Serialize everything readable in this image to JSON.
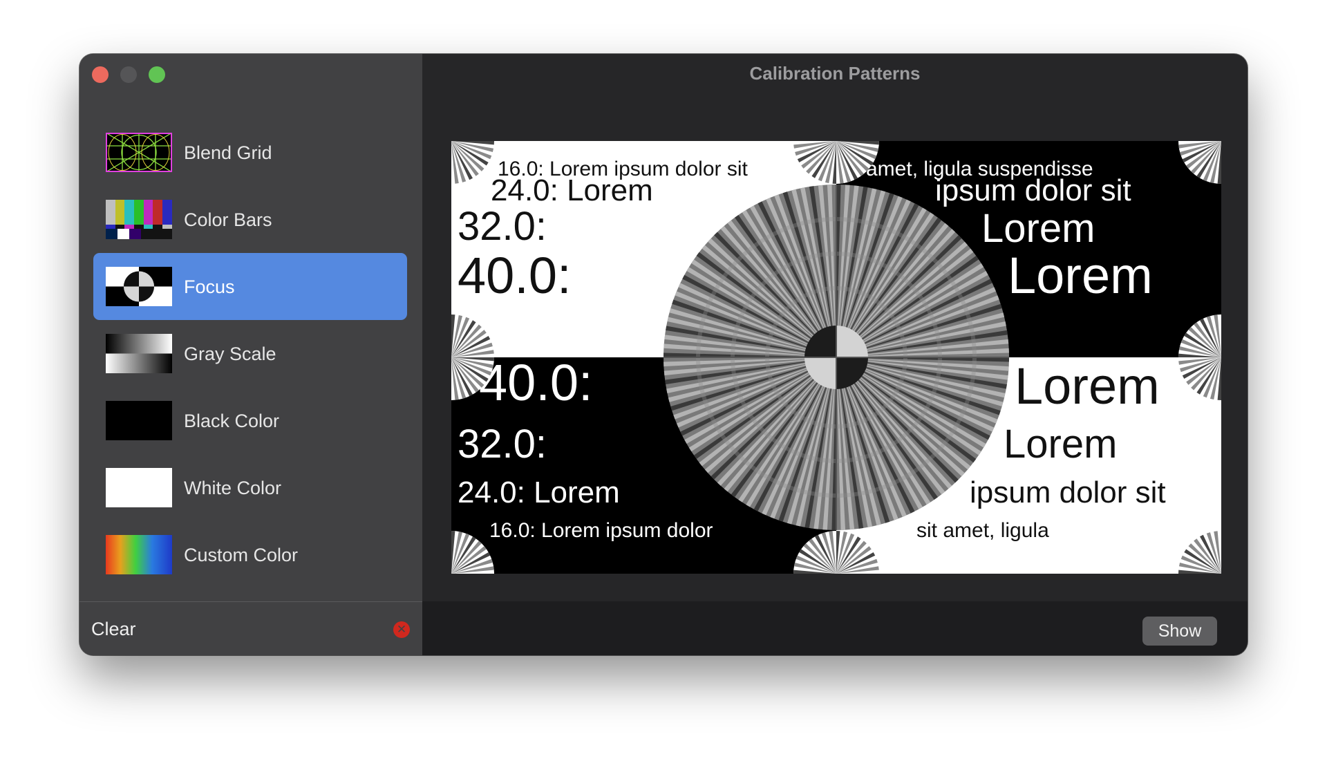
{
  "window": {
    "title": "Calibration Patterns"
  },
  "sidebar": {
    "items": [
      {
        "label": "Blend Grid",
        "icon": "blend-grid-icon",
        "selected": false
      },
      {
        "label": "Color Bars",
        "icon": "color-bars-icon",
        "selected": false
      },
      {
        "label": "Focus",
        "icon": "focus-icon",
        "selected": true
      },
      {
        "label": "Gray Scale",
        "icon": "gray-scale-icon",
        "selected": false
      },
      {
        "label": "Black Color",
        "icon": "black-color-icon",
        "selected": false
      },
      {
        "label": "White Color",
        "icon": "white-color-icon",
        "selected": false
      },
      {
        "label": "Custom Color",
        "icon": "custom-color-icon",
        "selected": false
      }
    ],
    "footer": {
      "clear_label": "Clear",
      "clear_icon": "clear-x-icon"
    }
  },
  "preview": {
    "top_left": [
      "16.0: Lorem ipsum dolor sit",
      "24.0: Lorem",
      "32.0:",
      "40.0:"
    ],
    "top_right": [
      "amet, ligula suspendisse",
      "ipsum dolor sit",
      "Lorem",
      "Lorem"
    ],
    "bottom_left": [
      "40.0:",
      "32.0:",
      "24.0: Lorem",
      "16.0: Lorem ipsum dolor"
    ],
    "bottom_right": [
      "Lorem",
      "Lorem",
      "ipsum dolor sit",
      "sit amet, ligula"
    ]
  },
  "toolbar": {
    "show_label": "Show"
  },
  "colors": {
    "selection": "#5589e0",
    "sidebar_bg": "#414143",
    "content_bg": "#262628",
    "close": "#ed6a5e",
    "zoom": "#61c454",
    "clear_icon": "#d0281e"
  }
}
